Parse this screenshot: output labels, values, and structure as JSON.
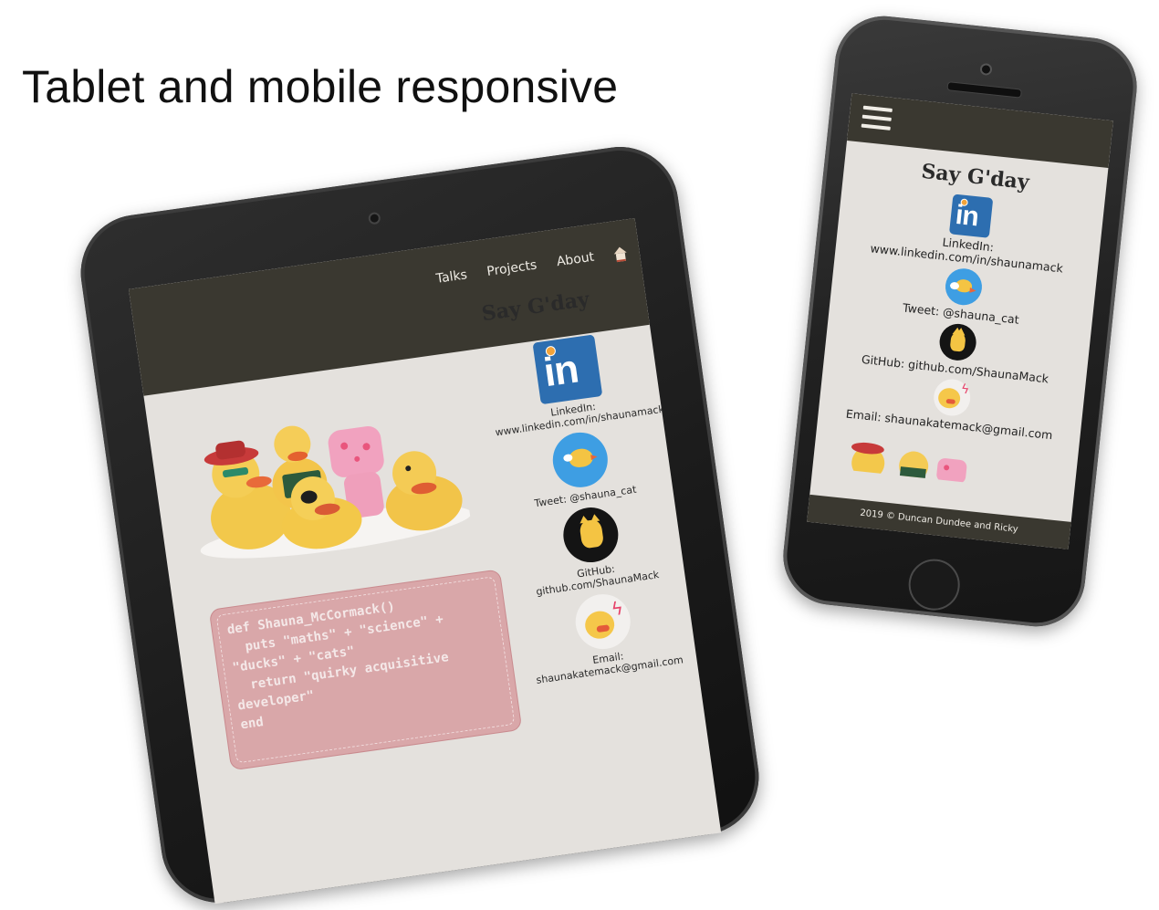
{
  "headline": "Tablet and mobile responsive",
  "tablet": {
    "nav": {
      "links": [
        "Talks",
        "Projects",
        "About"
      ],
      "home_icon": "house-icon"
    },
    "title": "Say G'day",
    "code_lines": [
      "def Shauna_McCormack()",
      "  puts \"maths\" + \"science\" +",
      "\"ducks\" + \"cats\"",
      "  return \"quirky acquisitive",
      "developer\"",
      "end"
    ],
    "contacts": {
      "linkedin": {
        "label": "LinkedIn:",
        "value": "www.linkedin.com/in/shaunamack"
      },
      "tweet": "Tweet: @shauna_cat",
      "github": "GitHub: github.com/ShaunaMack",
      "email": {
        "label": "Email:",
        "value": "shaunakatemack@gmail.com"
      }
    },
    "linkedin_logo_text": "in",
    "email_avatar_bolt": "ϟ"
  },
  "phone": {
    "title": "Say G'day",
    "contacts": {
      "linkedin": {
        "label": "LinkedIn:",
        "value": "www.linkedin.com/in/shaunamack"
      },
      "tweet": "Tweet: @shauna_cat",
      "github": "GitHub: github.com/ShaunaMack",
      "email": "Email: shaunakatemack@gmail.com"
    },
    "linkedin_logo_text": "in",
    "footer": "2019 © Duncan Dundee and Ricky"
  },
  "colors": {
    "nav_bg": "#3a3830",
    "page_bg": "#e4e1dd",
    "code_bg": "#d9a7a9",
    "linkedin_blue": "#2d6eb0",
    "twitter_blue": "#3e9ee3"
  }
}
